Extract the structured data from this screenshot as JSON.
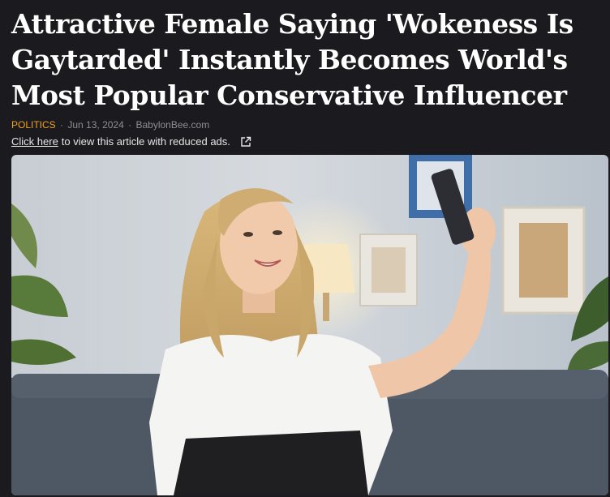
{
  "article": {
    "headline": "Attractive Female Saying 'Wokeness Is Gaytarded' Instantly Becomes World's Most Popular Conservative Influencer",
    "category": "POLITICS",
    "date": "Jun 13, 2024",
    "source": "BabylonBee.com",
    "separator": "·",
    "reduced_ads_link": "Click here",
    "reduced_ads_text": "to view this article with reduced ads."
  },
  "icons": {
    "external_link": "external-link-icon"
  },
  "colors": {
    "background": "#1b1b1f",
    "headline": "#ffffff",
    "category": "#f0a020",
    "meta": "#8d8d93"
  }
}
